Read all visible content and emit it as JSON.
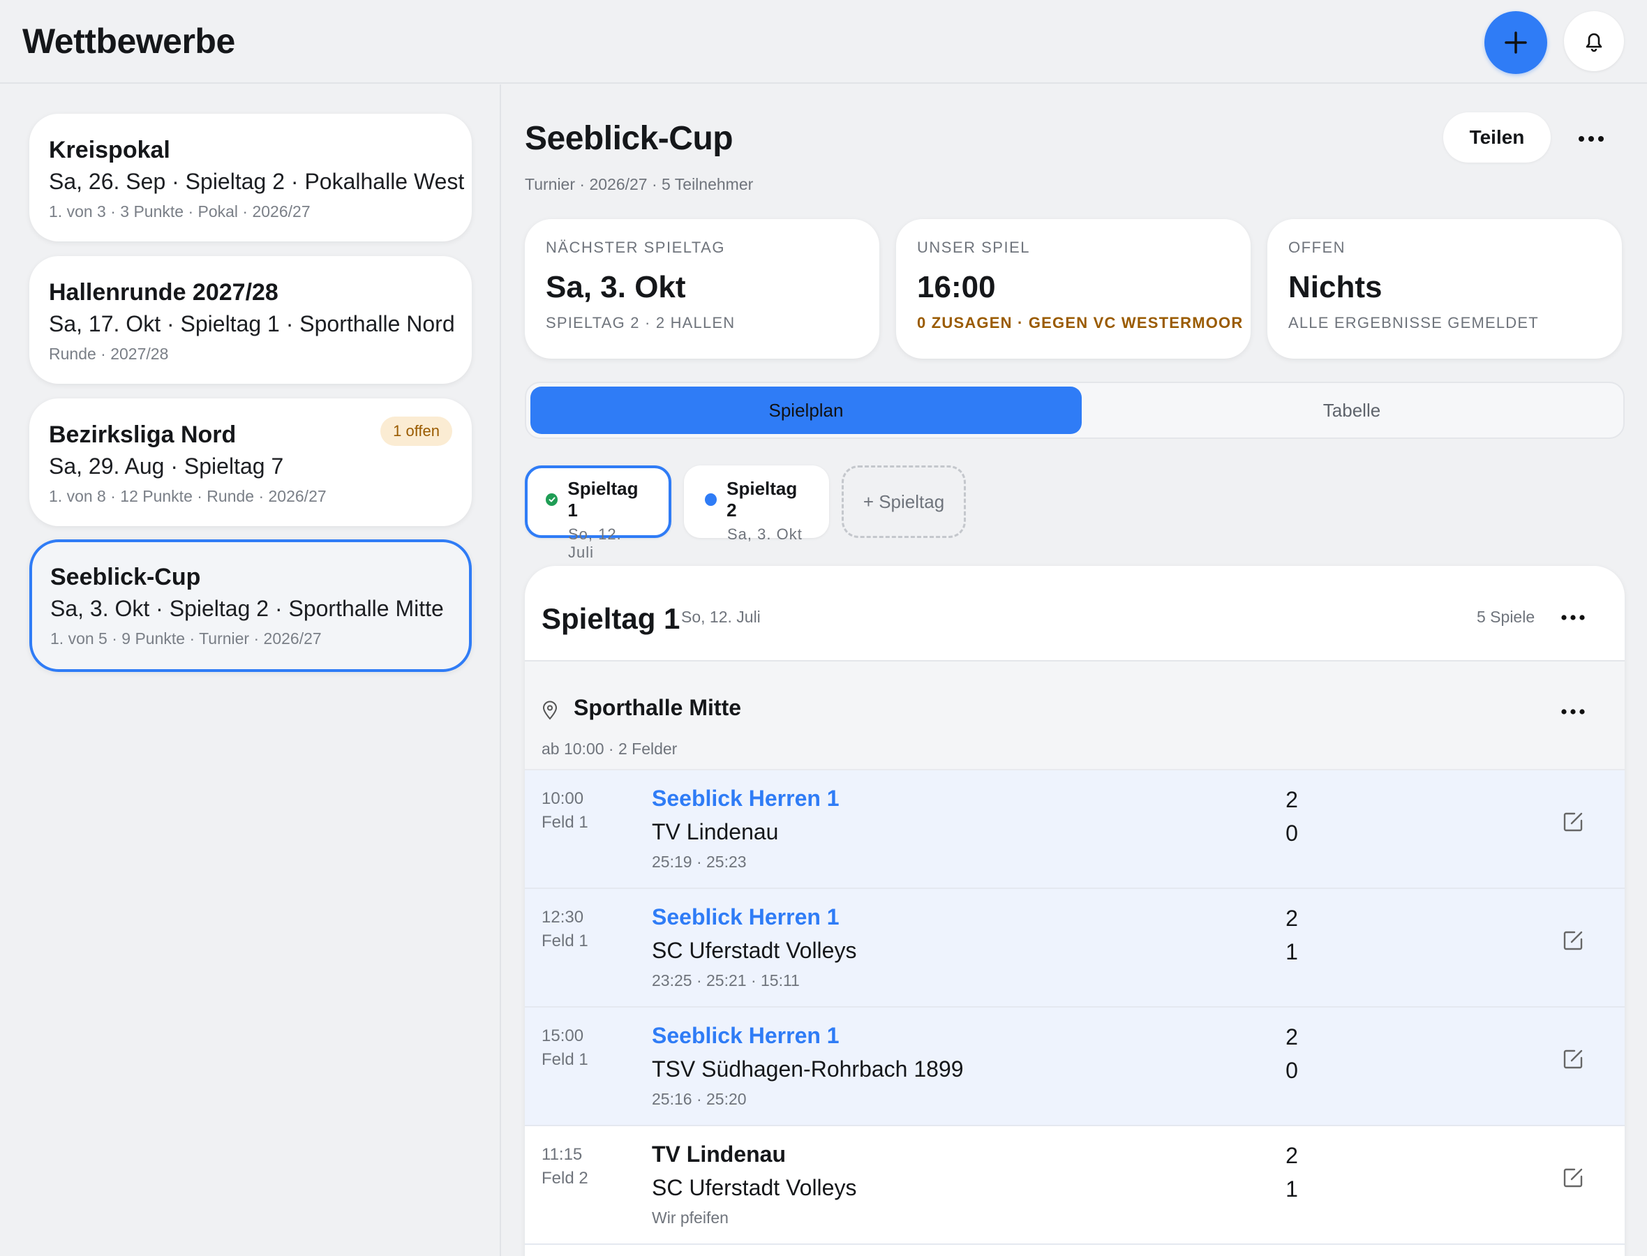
{
  "header": {
    "title": "Wettbewerbe",
    "add_icon": "plus-icon",
    "bell_icon": "bell-icon"
  },
  "sidebar": {
    "competitions": [
      {
        "name": "Kreispokal",
        "line": "Sa, 26. Sep · Spieltag 2 · Pokalhalle West",
        "meta": "1. von 3 · 3 Punkte · Pokal · 2026/27",
        "badge": ""
      },
      {
        "name": "Hallenrunde 2027/28",
        "line": "Sa, 17. Okt · Spieltag 1 · Sporthalle Nord",
        "meta": "Runde · 2027/28",
        "badge": ""
      },
      {
        "name": "Bezirksliga Nord",
        "line": "Sa, 29. Aug · Spieltag 7",
        "meta": "1. von 8 · 12 Punkte · Runde · 2026/27",
        "badge": "1 offen"
      },
      {
        "name": "Seeblick-Cup",
        "line": "Sa, 3. Okt · Spieltag 2 · Sporthalle Mitte",
        "meta": "1. von 5 · 9 Punkte · Turnier · 2026/27",
        "badge": ""
      }
    ],
    "selected_index": 3
  },
  "main": {
    "title": "Seeblick-Cup",
    "meta": "Turnier · 2026/27 · 5 Teilnehmer",
    "share_label": "Teilen",
    "info_cards": [
      {
        "label": "NÄCHSTER SPIELTAG",
        "value": "Sa, 3. Okt",
        "sub": "SPIELTAG 2 · 2 HALLEN"
      },
      {
        "label": "UNSER SPIEL",
        "value": "16:00",
        "sub": "0 ZUSAGEN · GEGEN VC WESTERMOOR"
      },
      {
        "label": "OFFEN",
        "value": "Nichts",
        "sub": "ALLE ERGEBNISSE GEMELDET"
      }
    ],
    "tabs": [
      {
        "label": "Spielplan",
        "active": true
      },
      {
        "label": "Tabelle",
        "active": false
      }
    ],
    "matchdays": [
      {
        "title": "Spieltag 1",
        "date": "So, 12. Juli",
        "status": "done"
      },
      {
        "title": "Spieltag 2",
        "date": "Sa, 3. Okt",
        "status": "upcoming"
      }
    ],
    "add_matchday_label": "+ Spieltag",
    "panel": {
      "title": "Spieltag 1",
      "date": "So, 12. Juli",
      "count": "5 Spiele",
      "venue": {
        "name": "Sporthalle Mitte",
        "meta": "ab 10:00 · 2 Felder"
      },
      "matches": [
        {
          "time": "10:00",
          "field": "Feld 1",
          "home": "Seeblick Herren 1",
          "away": "TV Lindenau",
          "home_score": "2",
          "away_score": "0",
          "sets": "25:19  ·  25:23",
          "ours": true
        },
        {
          "time": "12:30",
          "field": "Feld 1",
          "home": "Seeblick Herren 1",
          "away": "SC Uferstadt Volleys",
          "home_score": "2",
          "away_score": "1",
          "sets": "23:25  ·  25:21  ·  15:11",
          "ours": true
        },
        {
          "time": "15:00",
          "field": "Feld 1",
          "home": "Seeblick Herren 1",
          "away": "TSV Südhagen-Rohrbach 1899",
          "home_score": "2",
          "away_score": "0",
          "sets": "25:16  ·  25:20",
          "ours": true
        },
        {
          "time": "11:15",
          "field": "Feld 2",
          "home": "TV Lindenau",
          "away": "SC Uferstadt Volleys",
          "home_score": "2",
          "away_score": "1",
          "sets": "Wir pfeifen",
          "ours": false
        }
      ]
    }
  },
  "colors": {
    "accent": "#2f7cf6",
    "success": "#1f9d55",
    "warning": "#9a5b00",
    "our_row_bg": "#eef3fd"
  }
}
